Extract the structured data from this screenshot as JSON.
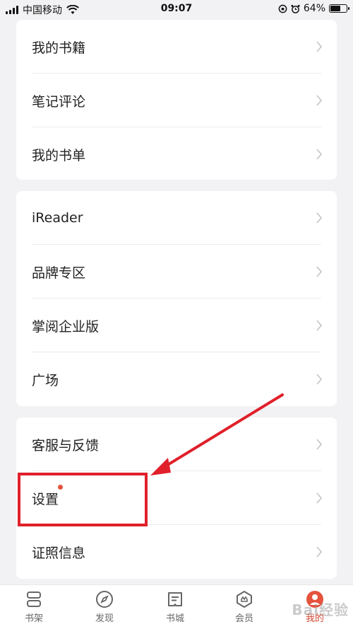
{
  "status_bar": {
    "carrier": "中国移动",
    "time": "09:07",
    "battery": "64%"
  },
  "section_1": [
    {
      "label": "我的书籍"
    },
    {
      "label": "笔记评论"
    },
    {
      "label": "我的书单"
    }
  ],
  "section_2": [
    {
      "label": "iReader"
    },
    {
      "label": "品牌专区"
    },
    {
      "label": "掌阅企业版"
    },
    {
      "label": "广场"
    }
  ],
  "section_3": [
    {
      "label": "客服与反馈"
    },
    {
      "label": "设置"
    },
    {
      "label": "证照信息"
    }
  ],
  "tabs": [
    {
      "label": "书架",
      "icon": "bookshelf-icon"
    },
    {
      "label": "发现",
      "icon": "compass-icon"
    },
    {
      "label": "书城",
      "icon": "bookstore-icon"
    },
    {
      "label": "会员",
      "icon": "member-icon"
    },
    {
      "label": "我的",
      "icon": "profile-icon",
      "active": true
    }
  ],
  "watermark": "Bai经验",
  "colors": {
    "accent": "#d6452f",
    "annotation": "#e0202a",
    "background": "#f2f2f4"
  }
}
